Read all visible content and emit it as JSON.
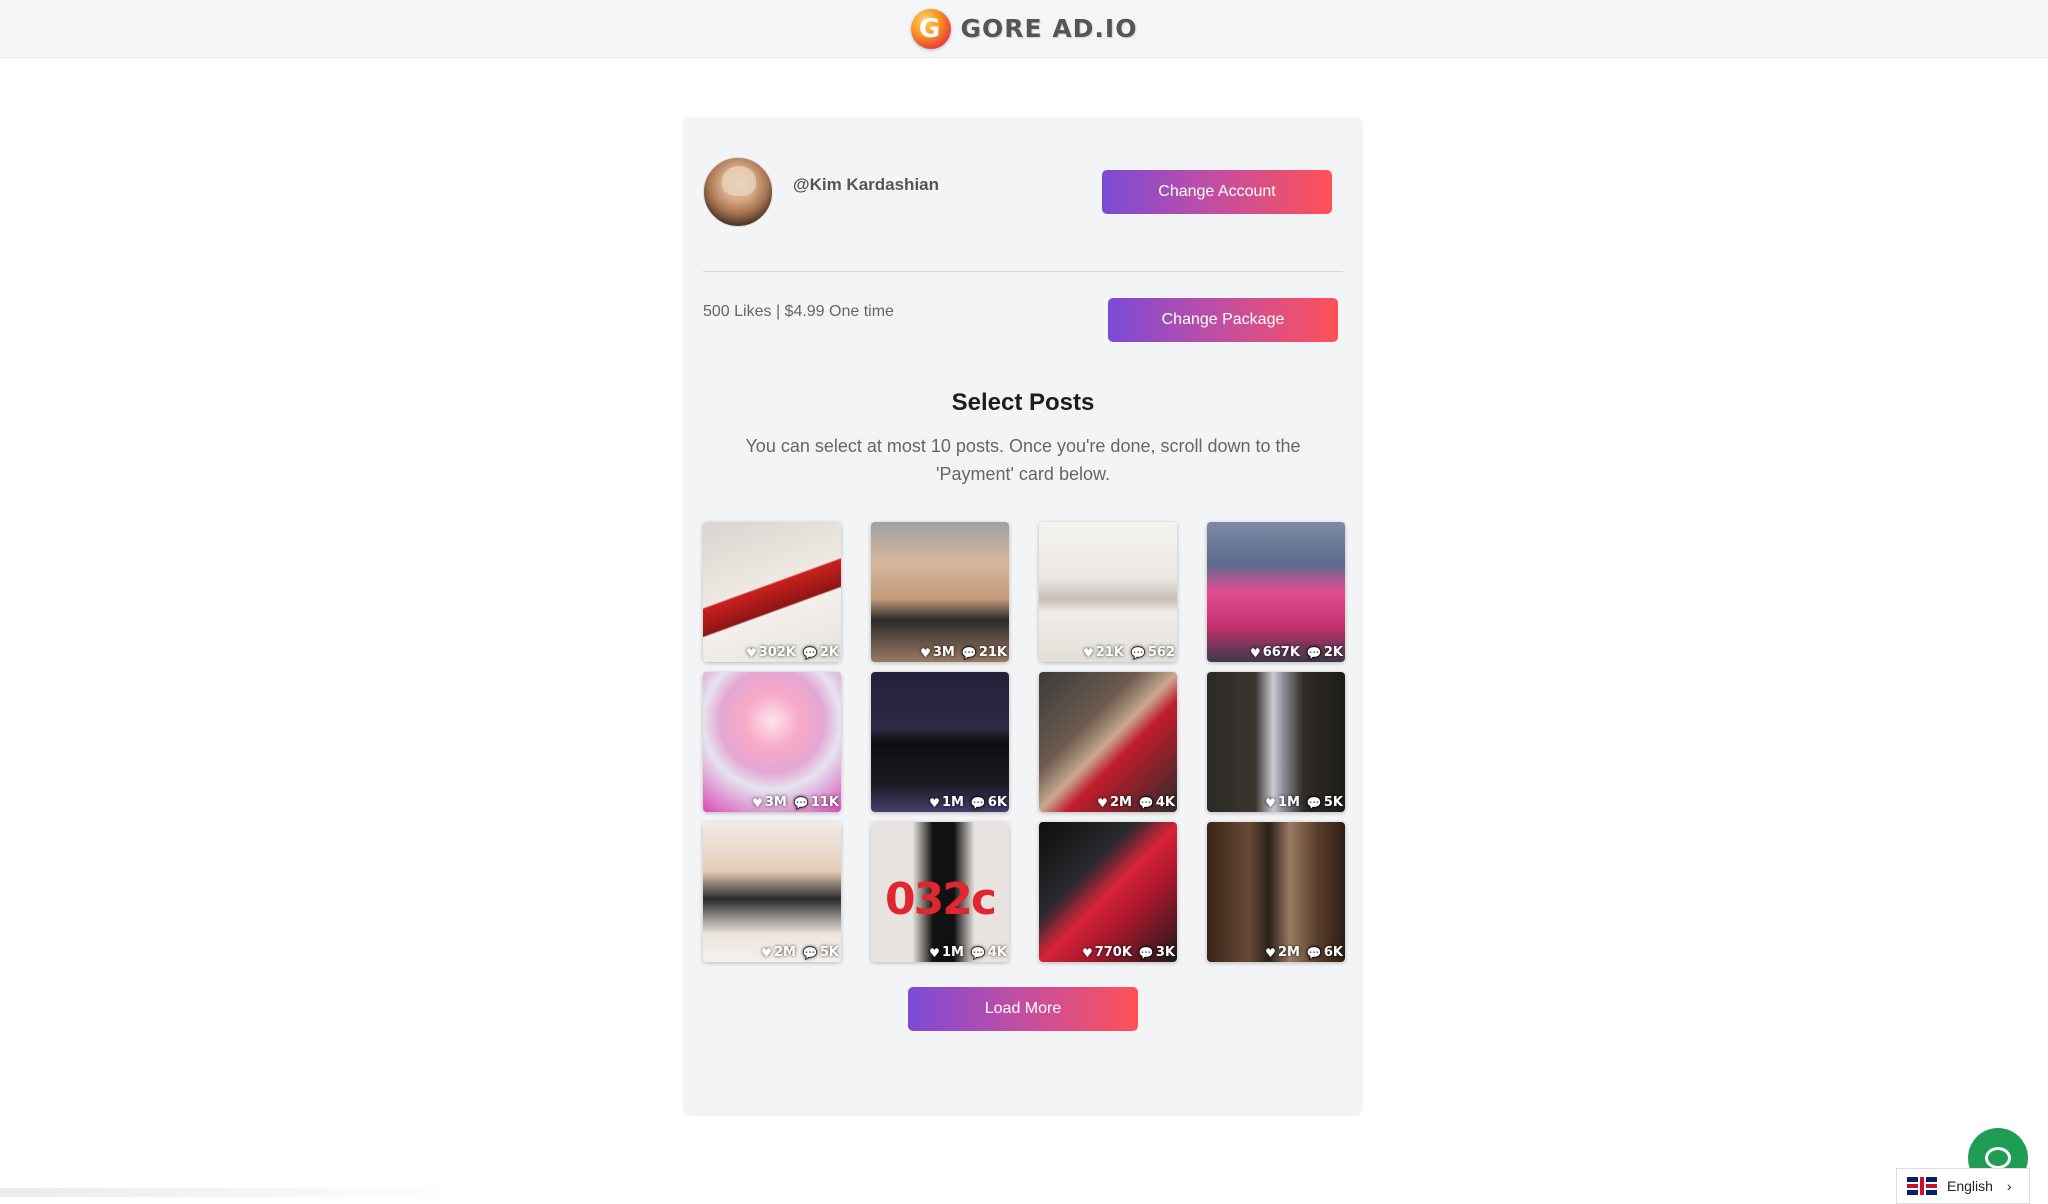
{
  "header": {
    "logo_letter": "G",
    "logo_text": "GORE AD.IO"
  },
  "account": {
    "username": "@Kim Kardashian",
    "change_account_label": "Change Account"
  },
  "package": {
    "text": "500 Likes | $4.99 One time",
    "change_package_label": "Change Package"
  },
  "section": {
    "title": "Select Posts",
    "description": "You can select at most 10 posts. Once you're done, scroll down to the 'Payment' card below."
  },
  "posts": [
    {
      "likes": "302K",
      "comments": "2K"
    },
    {
      "likes": "3M",
      "comments": "21K"
    },
    {
      "likes": "21K",
      "comments": "562"
    },
    {
      "likes": "667K",
      "comments": "2K"
    },
    {
      "likes": "3M",
      "comments": "11K"
    },
    {
      "likes": "1M",
      "comments": "6K"
    },
    {
      "likes": "2M",
      "comments": "4K"
    },
    {
      "likes": "1M",
      "comments": "5K"
    },
    {
      "likes": "2M",
      "comments": "5K"
    },
    {
      "likes": "1M",
      "comments": "4K"
    },
    {
      "likes": "770K",
      "comments": "3K"
    },
    {
      "likes": "2M",
      "comments": "6K"
    }
  ],
  "load_more_label": "Load More",
  "language": {
    "label": "English"
  },
  "icons": {
    "like": "heart-icon",
    "comment": "comment-icon",
    "chat": "chat-icon",
    "flag": "uk-flag-icon"
  }
}
